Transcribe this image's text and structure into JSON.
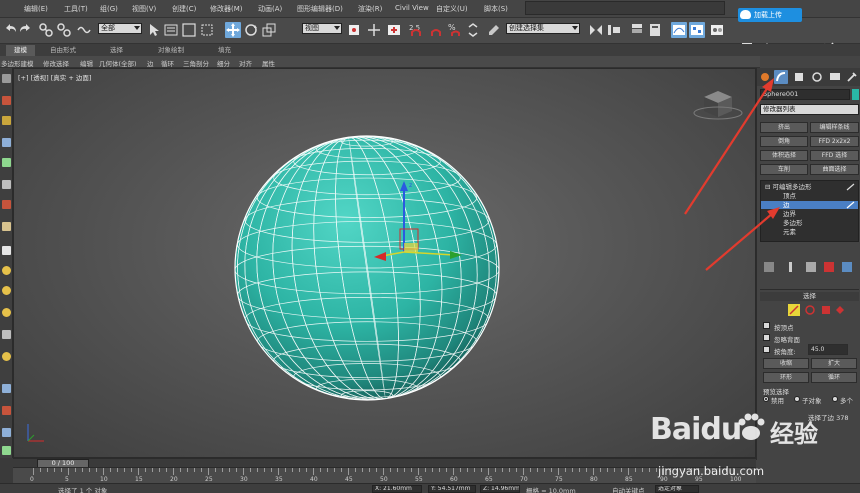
{
  "menubar": {
    "items": [
      "编辑(E)",
      "工具(T)",
      "组(G)",
      "视图(V)",
      "创建(C)",
      "修改器(M)",
      "动画(A)",
      "图形编辑器(D)",
      "渲染(R)",
      "Civil View",
      "自定义(U)",
      "脚本(S)"
    ],
    "login_label": "加载上传"
  },
  "toolbar": {
    "filter_select": "全部",
    "ref_coord_select": "视图",
    "named_selection_select": "创建选择集"
  },
  "ribbon": {
    "tabs": [
      "建模",
      "自由形式",
      "选择",
      "对象绘制",
      "填充"
    ],
    "sub_items": [
      "多边形建模",
      "修改选择",
      "编辑",
      "几何体(全部)",
      "边",
      "循环",
      "三角剖分",
      "细分",
      "对齐",
      "属性"
    ]
  },
  "viewport": {
    "label": "[+] [透视] [真实 + 边面]"
  },
  "panel": {
    "object_name": "Sphere001",
    "object_color": "#29b8a7",
    "modifier_list": "修改器列表",
    "buttons": [
      "挤出",
      "编辑样条线",
      "倒角",
      "FFD 2x2x2",
      "体积选择",
      "FFD 选择",
      "车削",
      "曲面选择"
    ],
    "stack": {
      "head": "可编辑多边形",
      "items": [
        "顶点",
        "边",
        "边界",
        "多边形",
        "元素"
      ],
      "selected_index": 1
    },
    "selection": {
      "title": "选择",
      "by_vertex": "按顶点",
      "ignore_backfacing": "忽略背面",
      "by_angle": "按角度:",
      "angle_value": "45.0",
      "shrink": "收缩",
      "grow": "扩大",
      "ring": "环形",
      "loop": "循环",
      "preview_title": "预览选择",
      "preview_options": [
        "禁用",
        "子对象",
        "多个"
      ],
      "status": "选择了边 378"
    }
  },
  "timeline": {
    "frame_label": "0 / 100",
    "ticks": [
      0,
      5,
      10,
      15,
      20,
      25,
      30,
      35,
      40,
      45,
      50,
      55,
      60,
      65,
      70,
      75,
      80,
      85,
      90,
      95,
      100
    ]
  },
  "status": {
    "selection": "选择了 1 个 对象",
    "x": "X: 21.60mm",
    "y": "Y: 54.517mm",
    "z": "Z: 14.96mm",
    "grid": "栅格 = 10.0mm",
    "autokey": "自动关键点",
    "selected_objects": "选定对象"
  },
  "watermark": {
    "brand": "Baidu",
    "product": "经验",
    "url": "jingyan.baidu.com"
  }
}
